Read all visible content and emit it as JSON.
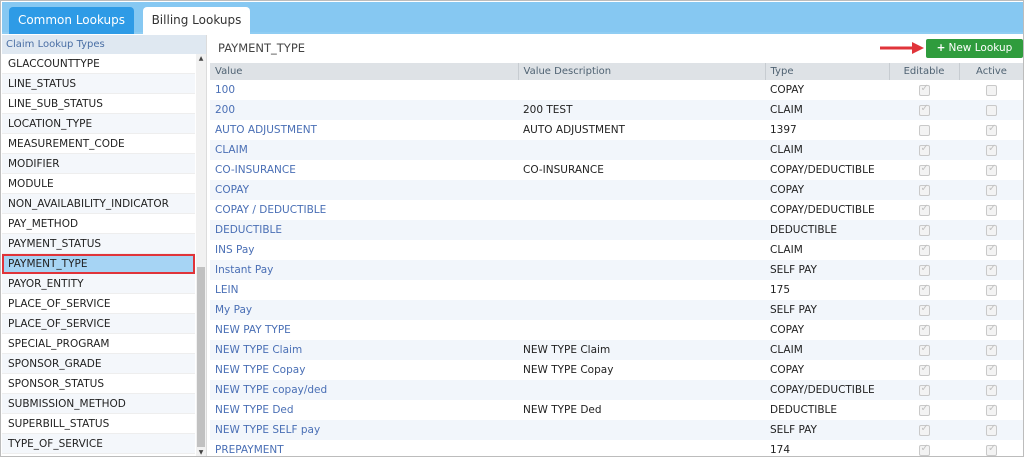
{
  "tabs": [
    {
      "label": "Common Lookups"
    },
    {
      "label": "Billing Lookups"
    }
  ],
  "sidebar": {
    "header": "Claim Lookup Types",
    "items": [
      {
        "label": "GLACCOUNTTYPE"
      },
      {
        "label": "LINE_STATUS"
      },
      {
        "label": "LINE_SUB_STATUS"
      },
      {
        "label": "LOCATION_TYPE"
      },
      {
        "label": "MEASUREMENT_CODE"
      },
      {
        "label": "MODIFIER"
      },
      {
        "label": "MODULE"
      },
      {
        "label": "NON_AVAILABILITY_INDICATOR"
      },
      {
        "label": "PAY_METHOD"
      },
      {
        "label": "PAYMENT_STATUS"
      },
      {
        "label": "PAYMENT_TYPE"
      },
      {
        "label": "PAYOR_ENTITY"
      },
      {
        "label": "PLACE_OF_SERVICE"
      },
      {
        "label": "PLACE_OF_SERVICE"
      },
      {
        "label": "SPECIAL_PROGRAM"
      },
      {
        "label": "SPONSOR_GRADE"
      },
      {
        "label": "SPONSOR_STATUS"
      },
      {
        "label": "SUBMISSION_METHOD"
      },
      {
        "label": "SUPERBILL_STATUS"
      },
      {
        "label": "TYPE_OF_SERVICE"
      }
    ],
    "selected_index": 10
  },
  "main": {
    "title": "PAYMENT_TYPE",
    "new_button_label": "New Lookup",
    "columns": [
      "Value",
      "Value Description",
      "Type",
      "Editable",
      "Active"
    ],
    "rows": [
      {
        "value": "100",
        "description": "",
        "type": "COPAY",
        "editable": true,
        "active": false
      },
      {
        "value": "200",
        "description": "200 TEST",
        "type": "CLAIM",
        "editable": true,
        "active": false
      },
      {
        "value": "AUTO ADJUSTMENT",
        "description": "AUTO ADJUSTMENT",
        "type": "1397",
        "editable": false,
        "active": true
      },
      {
        "value": "CLAIM",
        "description": "",
        "type": "CLAIM",
        "editable": true,
        "active": true
      },
      {
        "value": "CO-INSURANCE",
        "description": "CO-INSURANCE",
        "type": "COPAY/DEDUCTIBLE",
        "editable": true,
        "active": true
      },
      {
        "value": "COPAY",
        "description": "",
        "type": "COPAY",
        "editable": true,
        "active": true
      },
      {
        "value": "COPAY / DEDUCTIBLE",
        "description": "",
        "type": "COPAY/DEDUCTIBLE",
        "editable": true,
        "active": true
      },
      {
        "value": "DEDUCTIBLE",
        "description": "",
        "type": "DEDUCTIBLE",
        "editable": true,
        "active": true
      },
      {
        "value": "INS Pay",
        "description": "",
        "type": "CLAIM",
        "editable": true,
        "active": true
      },
      {
        "value": "Instant Pay",
        "description": "",
        "type": "SELF PAY",
        "editable": true,
        "active": true
      },
      {
        "value": "LEIN",
        "description": "",
        "type": "175",
        "editable": true,
        "active": true
      },
      {
        "value": "My Pay",
        "description": "",
        "type": "SELF PAY",
        "editable": true,
        "active": true
      },
      {
        "value": "NEW PAY TYPE",
        "description": "",
        "type": "COPAY",
        "editable": true,
        "active": true
      },
      {
        "value": "NEW TYPE Claim",
        "description": "NEW TYPE Claim",
        "type": "CLAIM",
        "editable": true,
        "active": true
      },
      {
        "value": "NEW TYPE Copay",
        "description": "NEW TYPE Copay",
        "type": "COPAY",
        "editable": true,
        "active": true
      },
      {
        "value": "NEW TYPE copay/ded",
        "description": "",
        "type": "COPAY/DEDUCTIBLE",
        "editable": true,
        "active": true
      },
      {
        "value": "NEW TYPE Ded",
        "description": "NEW TYPE Ded",
        "type": "DEDUCTIBLE",
        "editable": true,
        "active": true
      },
      {
        "value": "NEW TYPE SELF pay",
        "description": "",
        "type": "SELF PAY",
        "editable": true,
        "active": true
      },
      {
        "value": "PREPAYMENT",
        "description": "",
        "type": "174",
        "editable": true,
        "active": true
      }
    ]
  },
  "colors": {
    "tab_bar": "#86c8f2",
    "active_tab": "#2e9be6",
    "new_button": "#2f9c3d",
    "highlight_outline": "#e0343a",
    "arrow": "#e0343a",
    "link_text": "#4a6fb5"
  },
  "icons": {
    "add": "plus-icon",
    "callout": "red-arrow-icon"
  }
}
